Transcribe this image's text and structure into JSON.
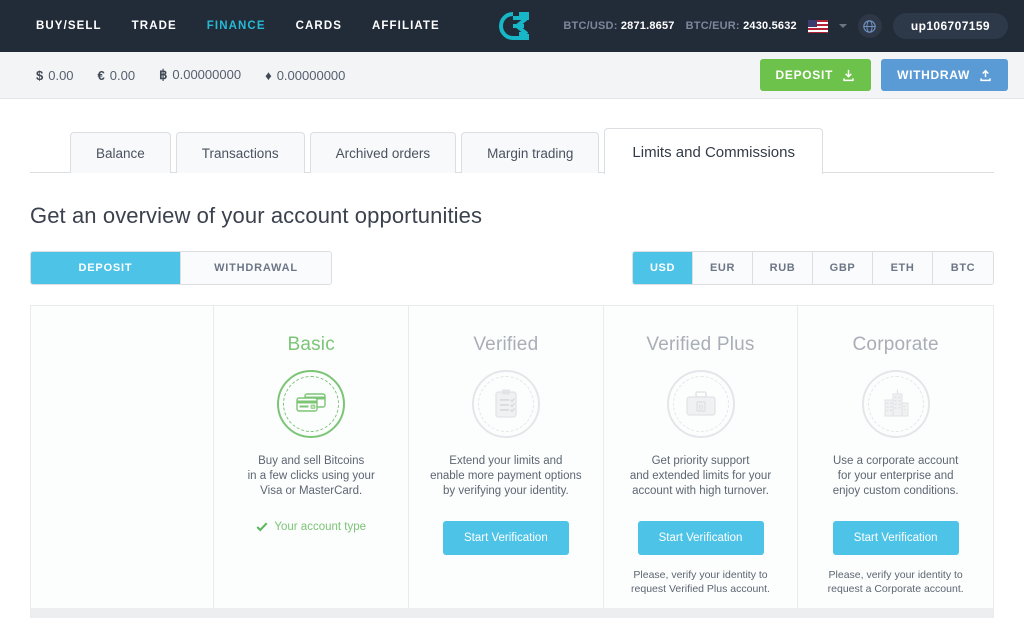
{
  "topnav": {
    "links": [
      {
        "label": "BUY/SELL",
        "active": false
      },
      {
        "label": "TRADE",
        "active": false
      },
      {
        "label": "FINANCE",
        "active": true
      },
      {
        "label": "CARDS",
        "active": false
      },
      {
        "label": "AFFILIATE",
        "active": false
      }
    ],
    "logo_icon": "cex-logo-icon",
    "rates": [
      {
        "label": "BTC/USD:",
        "value": "2871.8657"
      },
      {
        "label": "BTC/EUR:",
        "value": "2430.5632"
      }
    ],
    "flag_icon": "us-flag-icon",
    "chevron_icon": "chevron-down-icon",
    "globe_icon": "globe-icon",
    "username": "up106707159"
  },
  "balancebar": {
    "balances": [
      {
        "symbol": "$",
        "amount": "0.00"
      },
      {
        "symbol": "€",
        "amount": "0.00"
      },
      {
        "symbol": "฿",
        "amount": "0.00000000"
      },
      {
        "symbol": "♦",
        "amount": "0.00000000"
      }
    ],
    "deposit_label": "DEPOSIT",
    "deposit_icon": "download-icon",
    "withdraw_label": "WITHDRAW",
    "withdraw_icon": "upload-icon"
  },
  "tabs": [
    {
      "label": "Balance",
      "active": false
    },
    {
      "label": "Transactions",
      "active": false
    },
    {
      "label": "Archived orders",
      "active": false
    },
    {
      "label": "Margin trading",
      "active": false
    },
    {
      "label": "Limits and Commissions",
      "active": true
    }
  ],
  "main": {
    "title": "Get an overview of your account opportunities",
    "direction_toggle": [
      {
        "label": "DEPOSIT",
        "active": true
      },
      {
        "label": "WITHDRAWAL",
        "active": false
      }
    ],
    "currencies": [
      {
        "label": "USD",
        "active": true
      },
      {
        "label": "EUR",
        "active": false
      },
      {
        "label": "RUB",
        "active": false
      },
      {
        "label": "GBP",
        "active": false
      },
      {
        "label": "ETH",
        "active": false
      },
      {
        "label": "BTC",
        "active": false
      }
    ],
    "accounts": [
      {
        "title": "Basic",
        "icon": "credit-cards-icon",
        "description": "Buy and sell Bitcoins\nin a few clicks using your\nVisa or MasterCard.",
        "account_type_label": "Your account type",
        "check_icon": "check-icon"
      },
      {
        "title": "Verified",
        "icon": "clipboard-icon",
        "description": "Extend your limits and\nenable more payment options\nby verifying your identity.",
        "button_label": "Start Verification"
      },
      {
        "title": "Verified Plus",
        "icon": "briefcase-icon",
        "description": "Get priority support\nand extended limits for your\naccount with high turnover.",
        "button_label": "Start Verification",
        "note": "Please, verify your identity to\nrequest Verified Plus account."
      },
      {
        "title": "Corporate",
        "icon": "buildings-icon",
        "description": "Use a corporate account\nfor your enterprise and\nenjoy custom conditions.",
        "button_label": "Start Verification",
        "note": "Please, verify your identity to\nrequest a Corporate account."
      }
    ]
  },
  "colors": {
    "nav_bg": "#222b38",
    "accent_blue": "#4ec3e8",
    "accent_teal": "#27b9d4",
    "green": "#7cc576",
    "deposit_green": "#6cc24a",
    "withdraw_blue": "#5b9bd5"
  }
}
